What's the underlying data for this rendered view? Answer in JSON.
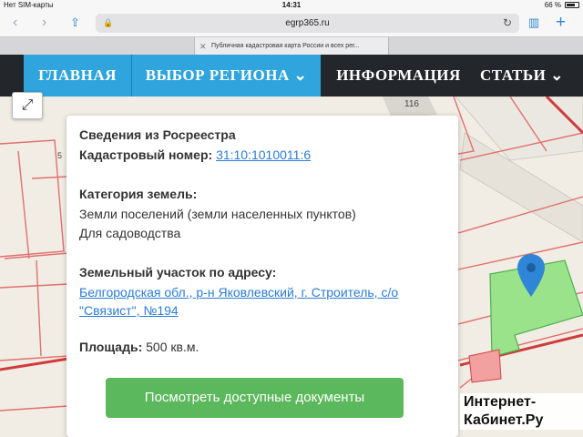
{
  "status_bar": {
    "carrier": "Нет SIM-карты",
    "time": "14:31",
    "battery": "66 %"
  },
  "toolbar": {
    "url": "egrp365.ru"
  },
  "tab": {
    "title": "Публичная кадастровая карта России и всех рег..."
  },
  "nav": {
    "items": [
      {
        "label": "ГЛАВНАЯ",
        "active": true
      },
      {
        "label": "ВЫБОР РЕГИОНА ⌄",
        "active": true
      },
      {
        "label": "ИНФОРМАЦИЯ",
        "active": false
      },
      {
        "label": "СТАТЬИ ⌄",
        "active": false
      }
    ]
  },
  "map": {
    "labels": [
      "116",
      "5"
    ]
  },
  "card": {
    "title": "Сведения из Росреестра",
    "cadastral_label": "Кадастровый номер:",
    "cadastral_value": "31:10:1010011:6",
    "category_label": "Категория земель:",
    "category_line1": "Земли поселений (земли населенных пунктов)",
    "category_line2": "Для садоводства",
    "address_label": "Земельный участок по адресу:",
    "address_line1": "Белгородская обл., р-н Яковлевский, г. Строитель, с/о",
    "address_line2": "\"Связист\", №194",
    "area_label": "Площадь:",
    "area_value": "500 кв.м.",
    "button_label": "Посмотреть доступные документы"
  },
  "watermark": {
    "line1": "Интернет-",
    "line2": "Кабинет.Ру"
  },
  "colors": {
    "nav_bg": "#23272c",
    "nav_active": "#2fa4dd",
    "link": "#2a7bd5",
    "button": "#5cb85c",
    "parcel": "#9be38a",
    "pin": "#2f86d6"
  }
}
